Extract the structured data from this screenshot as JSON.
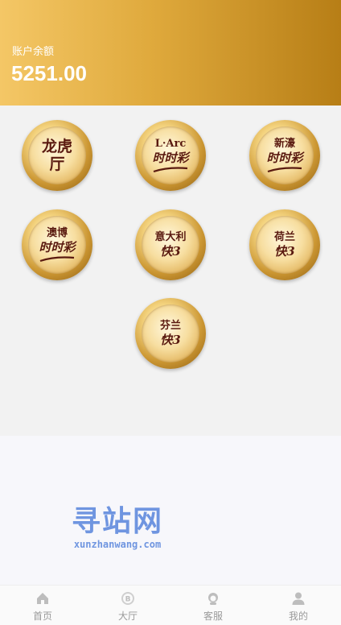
{
  "account": {
    "label": "账户余额",
    "balance": "5251.00"
  },
  "games": [
    {
      "line1": "龙虎",
      "line2": "厅"
    },
    {
      "top": "L·Arc",
      "sub": "时时彩"
    },
    {
      "top": "新濠",
      "sub": "时时彩"
    },
    {
      "top": "澳博",
      "sub": "时时彩"
    },
    {
      "top": "意大利",
      "sub": "快3"
    },
    {
      "top": "荷兰",
      "sub": "快3"
    },
    {
      "top": "芬兰",
      "sub": "快3"
    }
  ],
  "watermark": {
    "main": "寻站网",
    "sub": "xunzhanwang.com"
  },
  "tabbar": [
    {
      "label": "首页",
      "icon": "home-icon"
    },
    {
      "label": "大厅",
      "icon": "bitcoin-icon"
    },
    {
      "label": "客服",
      "icon": "service-icon"
    },
    {
      "label": "我的",
      "icon": "user-icon"
    }
  ],
  "colors": {
    "header_start": "#f4c766",
    "header_end": "#b77e16",
    "watermark": "#6f95e0"
  }
}
